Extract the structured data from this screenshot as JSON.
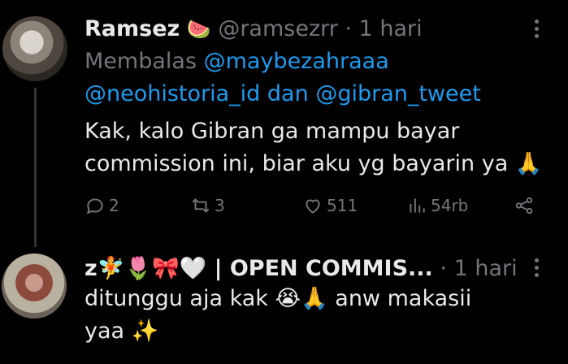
{
  "tweet1": {
    "name": "Ramsez",
    "name_emoji": "🍉",
    "handle": "@ramsezrr",
    "dot": "·",
    "time": "1 hari",
    "replying_prefix": "Membalas",
    "mention1": "@maybezahraaa",
    "mention2": "@neohistoria_id",
    "replying_and": "dan",
    "mention3": "@gibran_tweet",
    "text_line1": "Kak, kalo Gibran ga mampu bayar",
    "text_line2": "commission ini, biar aku yg bayarin ya 🙏",
    "replies": "2",
    "reposts": "3",
    "likes": "511",
    "views": "54rb"
  },
  "tweet2": {
    "name": "z🧚🌷🎀🤍 | OPEN COMMIS...",
    "dot": "·",
    "time": "1 hari",
    "text_line1": "ditunggu aja kak 😭🙏 anw makasii",
    "text_line2": "yaa ✨"
  },
  "colors": {
    "background": "#000000",
    "text": "#e7e9ea",
    "muted": "#71767b",
    "link": "#1d9bf0",
    "thread_line": "#333639"
  }
}
